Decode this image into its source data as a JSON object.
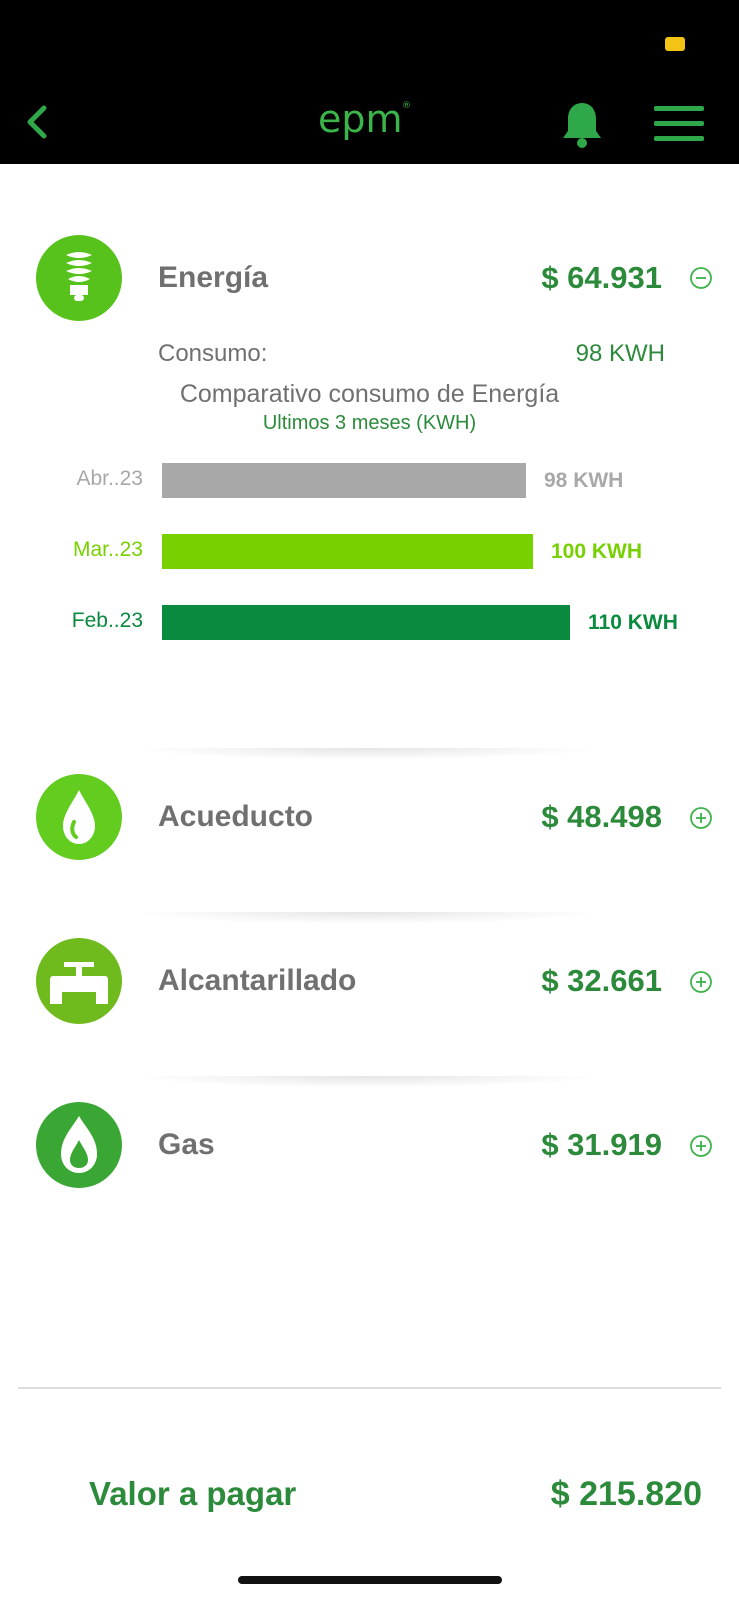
{
  "header": {
    "logo_text": "epm",
    "icons": [
      "chevron-left-icon",
      "bell-icon",
      "hamburger-menu-icon"
    ],
    "accent_color": "#3bb54a",
    "background_color": "#000000"
  },
  "services": [
    {
      "name": "Energía",
      "amount": "$ 64.931",
      "icon": "lightbulb-icon",
      "expanded": true,
      "toggle_icon": "minus-circle-icon"
    },
    {
      "name": "Acueducto",
      "amount": "$ 48.498",
      "icon": "water-drop-icon",
      "expanded": false,
      "toggle_icon": "plus-circle-icon"
    },
    {
      "name": "Alcantarillado",
      "amount": "$ 32.661",
      "icon": "pipe-valve-icon",
      "expanded": false,
      "toggle_icon": "plus-circle-icon"
    },
    {
      "name": "Gas",
      "amount": "$ 31.919",
      "icon": "flame-icon",
      "expanded": false,
      "toggle_icon": "plus-circle-icon"
    }
  ],
  "energy_detail": {
    "consumo_label": "Consumo:",
    "consumo_value": "98 KWH",
    "chart_title": "Comparativo consumo de Energía",
    "chart_subtitle": "Ultimos 3 meses (KWH)"
  },
  "chart_data": {
    "type": "bar",
    "orientation": "horizontal",
    "title": "Comparativo consumo de Energía",
    "subtitle": "Ultimos 3 meses (KWH)",
    "categories": [
      "Abr..23",
      "Mar..23",
      "Feb..23"
    ],
    "values": [
      98,
      100,
      110
    ],
    "value_labels": [
      "98 KWH",
      "100 KWH",
      "110 KWH"
    ],
    "colors": [
      "#a8a8a8",
      "#77d100",
      "#0a8a3e"
    ],
    "xlim": [
      0,
      122
    ],
    "grid": false
  },
  "footer": {
    "total_label": "Valor a pagar",
    "total_amount": "$ 215.820"
  }
}
